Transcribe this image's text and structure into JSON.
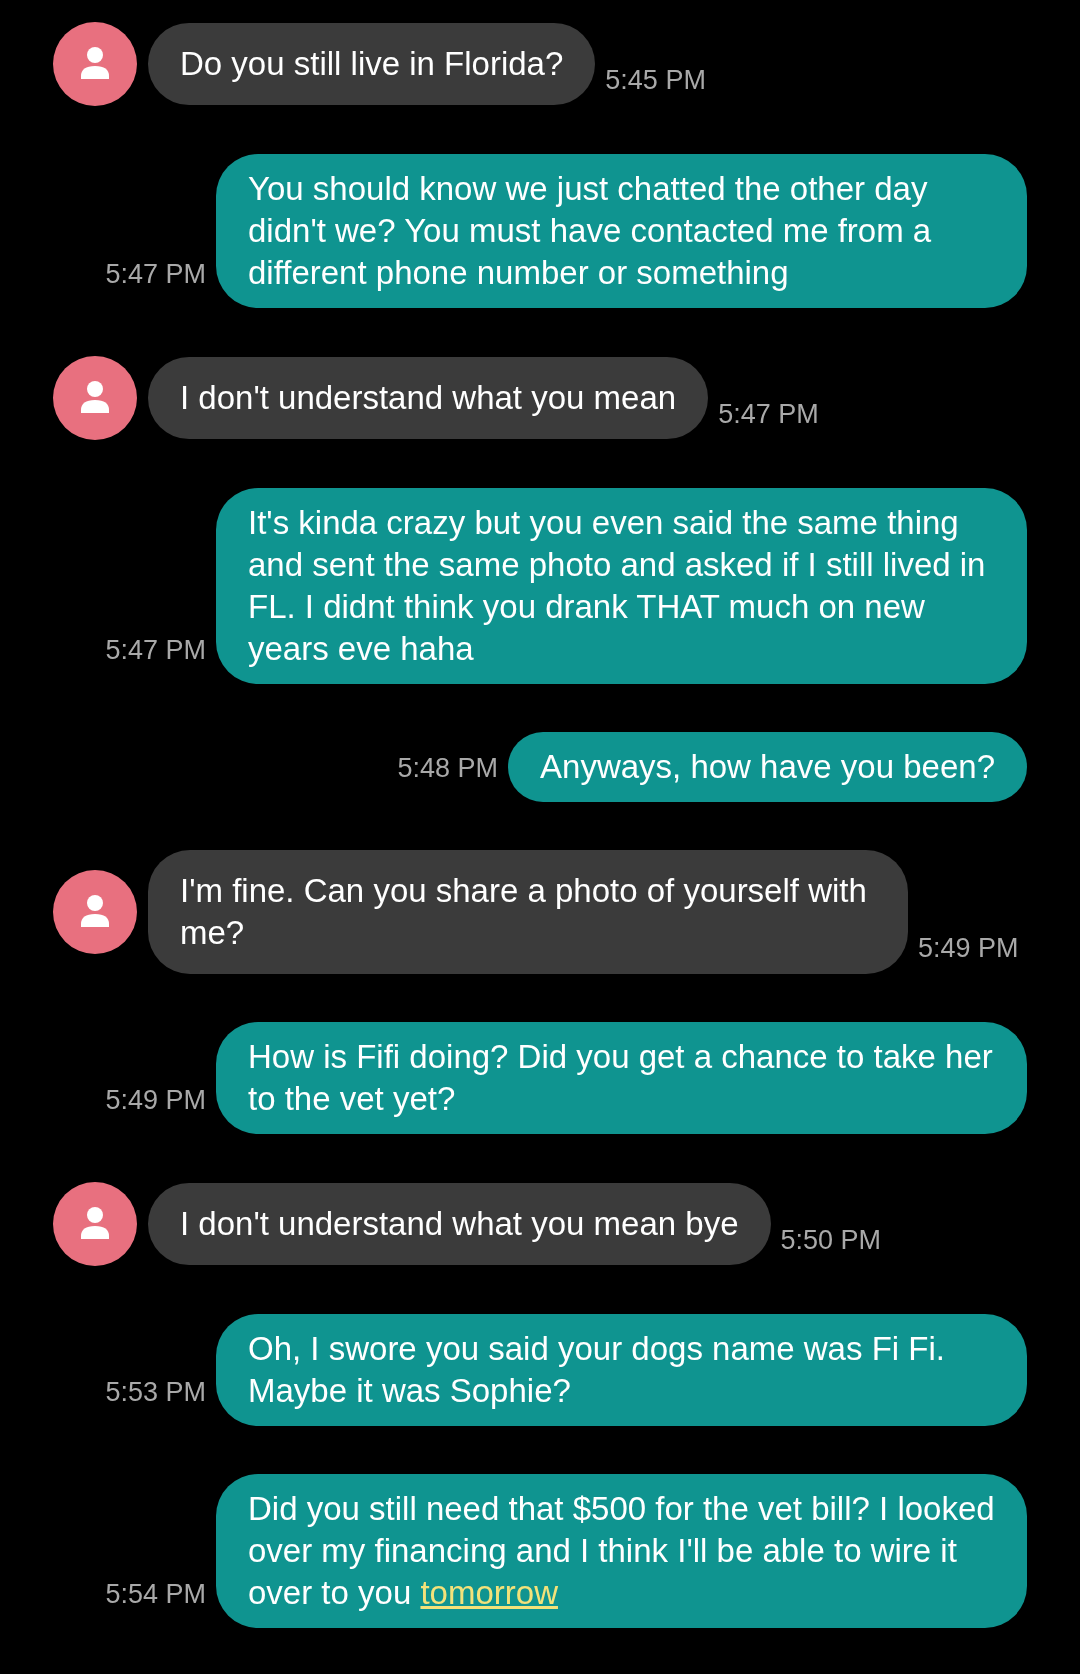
{
  "messages": [
    {
      "kind": "incoming",
      "parts": [
        {
          "text": "Do you still live in Florida?"
        }
      ],
      "time": "5:45 PM"
    },
    {
      "kind": "outgoing",
      "parts": [
        {
          "text": "You should know we just chatted the other day didn't we? You must have contacted me from a different phone number or something"
        }
      ],
      "time": "5:47 PM"
    },
    {
      "kind": "incoming",
      "parts": [
        {
          "text": "I don't understand what you mean"
        }
      ],
      "time": "5:47 PM"
    },
    {
      "kind": "outgoing",
      "parts": [
        {
          "text": "It's kinda crazy but you even said the same thing and sent the same photo and asked if I still lived in FL.  I didnt think you drank THAT much on new years eve haha"
        }
      ],
      "time": "5:47 PM"
    },
    {
      "kind": "outgoing",
      "parts": [
        {
          "text": "Anyways, how have you been?"
        }
      ],
      "time": "5:48 PM"
    },
    {
      "kind": "incoming",
      "parts": [
        {
          "text": "I'm fine. Can you share a photo of yourself with me?"
        }
      ],
      "time": "5:49 PM"
    },
    {
      "kind": "outgoing",
      "parts": [
        {
          "text": "How is Fifi doing? Did you get a chance to take her to the vet yet?"
        }
      ],
      "time": "5:49 PM"
    },
    {
      "kind": "incoming",
      "parts": [
        {
          "text": "I don't understand what you mean bye"
        }
      ],
      "time": "5:50 PM"
    },
    {
      "kind": "outgoing",
      "parts": [
        {
          "text": "Oh, I swore you said your dogs name was Fi Fi.  Maybe it was Sophie?"
        }
      ],
      "time": "5:53 PM"
    },
    {
      "kind": "outgoing",
      "parts": [
        {
          "text": "Did you still need that $500 for the vet bill?  I looked over my financing and I think I'll be able to wire it over to you "
        },
        {
          "link": "tomorrow"
        }
      ],
      "time": "5:54 PM"
    }
  ]
}
